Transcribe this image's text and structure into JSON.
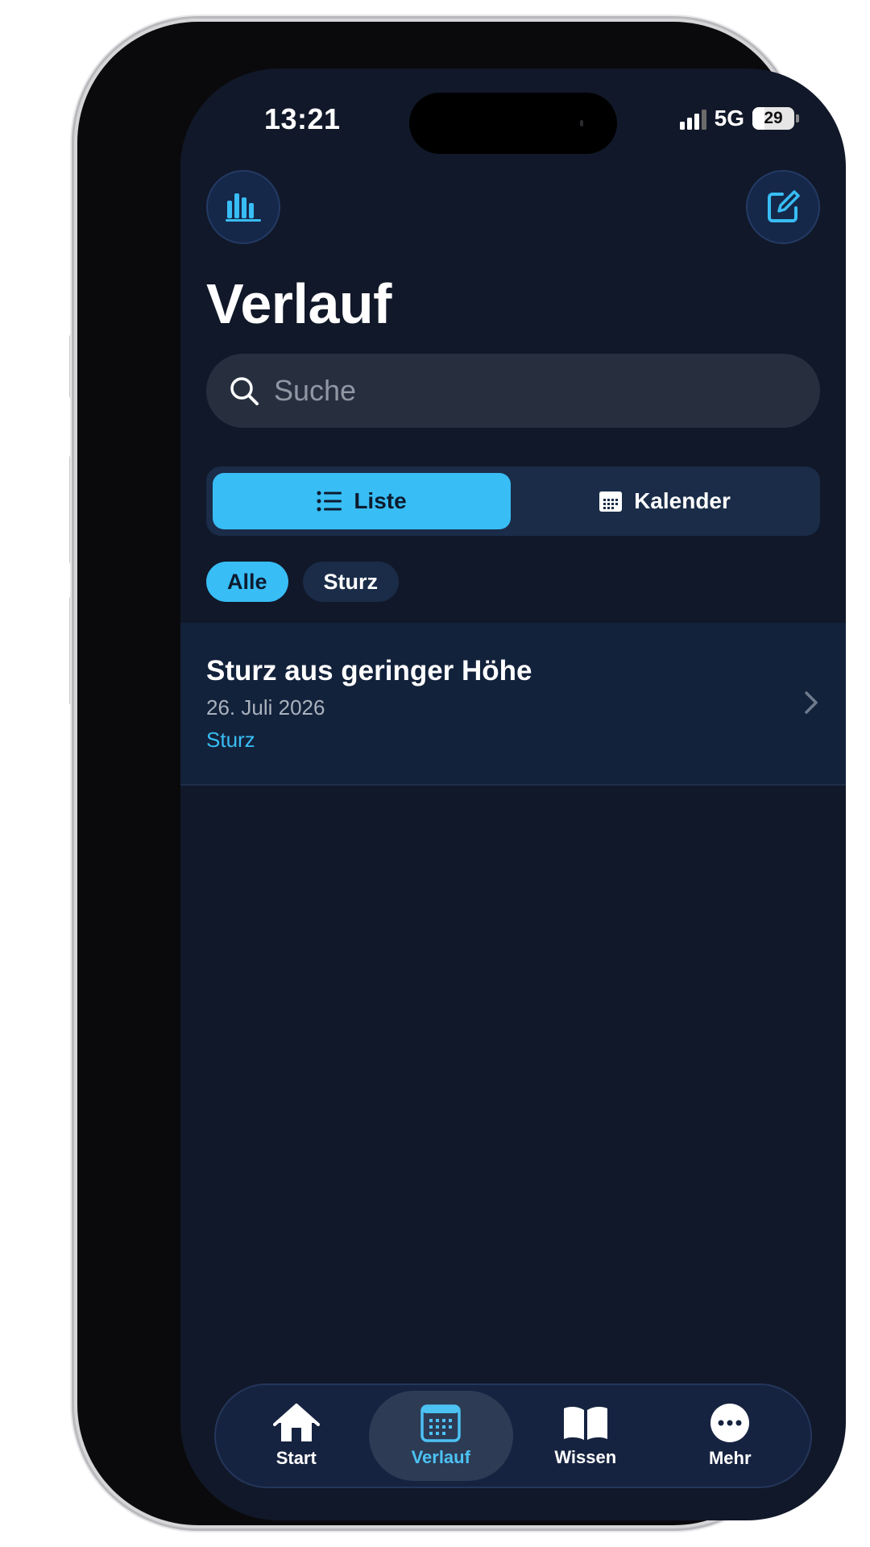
{
  "status_bar": {
    "time": "13:21",
    "network": "5G",
    "battery": "29"
  },
  "header": {
    "title": "Verlauf",
    "left_icon": "bar-chart-icon",
    "right_icon": "compose-icon"
  },
  "search": {
    "placeholder": "Suche",
    "value": ""
  },
  "view_toggle": {
    "options": [
      {
        "label": "Liste",
        "icon": "list-icon",
        "selected": true
      },
      {
        "label": "Kalender",
        "icon": "calendar-icon",
        "selected": false
      }
    ]
  },
  "filters": [
    {
      "label": "Alle",
      "selected": true
    },
    {
      "label": "Sturz",
      "selected": false
    }
  ],
  "entries": [
    {
      "title": "Sturz aus geringer Höhe",
      "date": "26. Juli 2026",
      "tag": "Sturz"
    }
  ],
  "tab_bar": {
    "tabs": [
      {
        "label": "Start",
        "icon": "home-icon",
        "selected": false
      },
      {
        "label": "Verlauf",
        "icon": "calendar-icon",
        "selected": true
      },
      {
        "label": "Wissen",
        "icon": "book-icon",
        "selected": false
      },
      {
        "label": "Mehr",
        "icon": "more-icon",
        "selected": false
      }
    ]
  },
  "colors": {
    "background": "#111829",
    "accent": "#38bdf5",
    "card": "#13223b"
  }
}
